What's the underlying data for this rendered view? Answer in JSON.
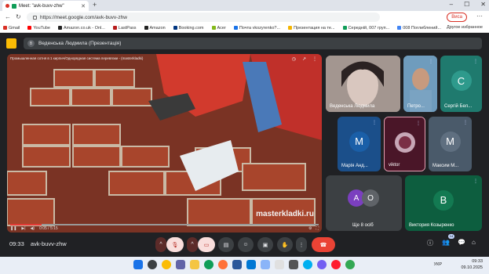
{
  "browser": {
    "tab_title": "Meet: \"avk-buvv-zhw\"",
    "url": "https://meet.google.com/avk-buvv-zhw",
    "profile_label": "Виса",
    "bookmarks": [
      {
        "label": "Gmail",
        "color": "#d93025"
      },
      {
        "label": "YouTube",
        "color": "#ff0000"
      },
      {
        "label": "Amazon.co.uk - Onl...",
        "color": "#222222"
      },
      {
        "label": "LastPass",
        "color": "#b71c1c"
      },
      {
        "label": "Amazon",
        "color": "#222222"
      },
      {
        "label": "Booking.com",
        "color": "#003580"
      },
      {
        "label": "Acer",
        "color": "#83b81a"
      },
      {
        "label": "Почта vkozyrenko?...",
        "color": "#1a73e8"
      },
      {
        "label": "Презентация на те...",
        "color": "#f4b400"
      },
      {
        "label": "Середній, 007 груп...",
        "color": "#0f9d58"
      },
      {
        "label": "008 Поглиблений...",
        "color": "#4285f4"
      }
    ],
    "bookmarks_other": "Другое избранное"
  },
  "meet": {
    "presenter_label": "Веденська Людмила (Презентація)",
    "video_title": "Промышленная сотня в 1 кирпич/Однорядная система перевязки - (masterkladki)",
    "watermark": "masterkladki.ru",
    "video_time": "0:05 / 5:15",
    "participants": [
      {
        "name": "Веденська Людмила",
        "initial": "",
        "color": "#8b7d79",
        "has_video": true
      },
      {
        "name": "Петро...",
        "initial": "",
        "color": "#5f8fb0",
        "has_video": true
      },
      {
        "name": "Сергій Бел...",
        "initial": "С",
        "color": "#1f7a6e",
        "has_video": false
      },
      {
        "name": "Марія Анд...",
        "initial": "М",
        "color": "#1b4f8a",
        "has_video": false
      },
      {
        "name": "viktor",
        "initial": "",
        "color": "#5a1e32",
        "has_video": true
      },
      {
        "name": "Максим М...",
        "initial": "М",
        "color": "#4a5a6a",
        "has_video": false
      },
      {
        "name": "Ще 8 осіб",
        "initial": "A",
        "initial2": "O",
        "color": "#3c4043",
        "has_video": false
      },
      {
        "name": "Виктория Козыренко",
        "initial": "B",
        "color": "#0d5e3f",
        "has_video": false
      }
    ],
    "time": "09:33",
    "meeting_code": "avk-buvv-zhw",
    "people_count": "14"
  },
  "taskbar": {
    "lang": "УКР",
    "clock_time": "09:33",
    "clock_date": "09.10.2025"
  }
}
